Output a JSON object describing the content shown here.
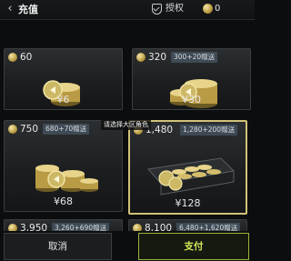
{
  "header": {
    "back_icon": "chevron-left-icon",
    "title": "充值",
    "auth_label": "授权",
    "balance": "0"
  },
  "packages": [
    {
      "amount": "60",
      "bonus": "",
      "price": "¥6"
    },
    {
      "amount": "320",
      "bonus": "300+20赠送",
      "price": "¥30"
    },
    {
      "amount": "750",
      "bonus": "680+70赠送",
      "price": "¥68"
    },
    {
      "amount": "1,480",
      "bonus": "1,280+200赠送",
      "price": "¥128",
      "selected": true
    },
    {
      "amount": "3,950",
      "bonus": "3,260+690赠送",
      "price": ""
    },
    {
      "amount": "8,100",
      "bonus": "6,480+1,620赠送",
      "price": ""
    }
  ],
  "tooltip": "请选择大区角色",
  "footer": {
    "cancel_label": "取消",
    "pay_label": "支付"
  },
  "colors": {
    "selected_border": "#d2c27a",
    "pay_accent": "#d6ea5a",
    "bonus_badge": "#3e4a55"
  }
}
